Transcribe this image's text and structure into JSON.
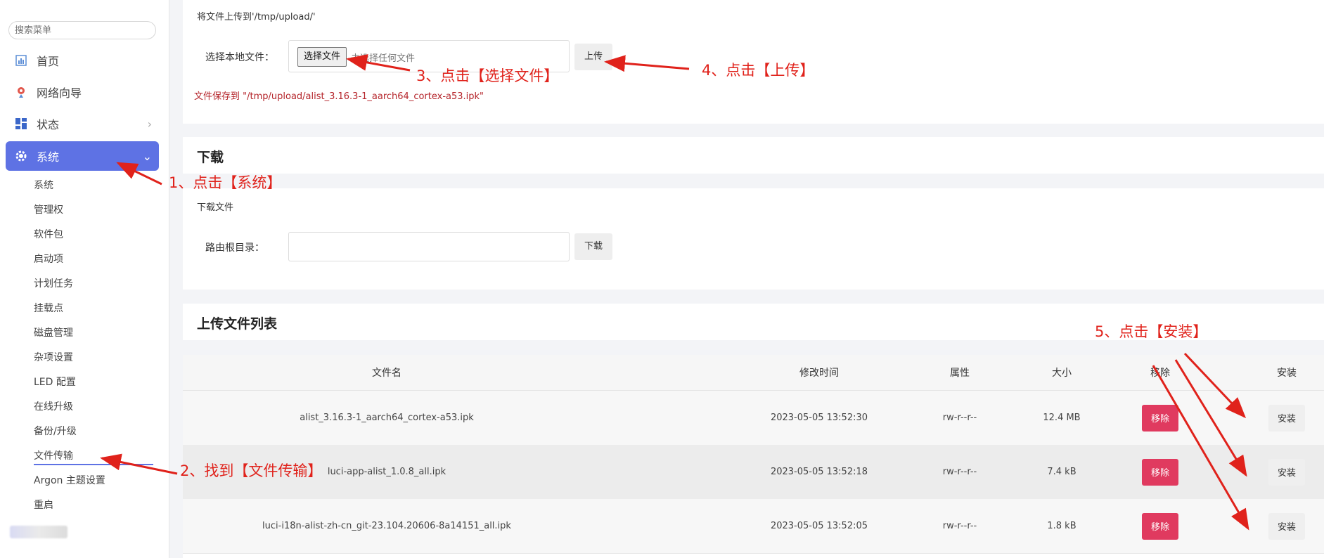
{
  "sidebar": {
    "search_placeholder": "搜索菜单",
    "items": [
      {
        "label": "首页",
        "icon": "chart-icon"
      },
      {
        "label": "网络向导",
        "icon": "pin-icon"
      },
      {
        "label": "状态",
        "icon": "grid-icon"
      },
      {
        "label": "系统",
        "icon": "gear-icon",
        "active": true
      }
    ],
    "sub_items": [
      "系统",
      "管理权",
      "软件包",
      "启动项",
      "计划任务",
      "挂载点",
      "磁盘管理",
      "杂项设置",
      "LED 配置",
      "在线升级",
      "备份/升级",
      "文件传输",
      "Argon 主题设置",
      "重启"
    ],
    "current_sub": "文件传输",
    "accent": "#5e72e4"
  },
  "upload": {
    "description": "将文件上传到'/tmp/upload/'",
    "local_file_label": "选择本地文件：",
    "choose_button": "选择文件",
    "no_file_text": "未选择任何文件",
    "upload_button": "上传",
    "saved_message": "文件保存到 \"/tmp/upload/alist_3.16.3-1_aarch64_cortex-a53.ipk\""
  },
  "download": {
    "title": "下载",
    "description": "下载文件",
    "path_label": "路由根目录：",
    "path_value": "",
    "download_button": "下载"
  },
  "file_list": {
    "title": "上传文件列表",
    "headers": {
      "name": "文件名",
      "mtime": "修改时间",
      "attr": "属性",
      "size": "大小",
      "remove": "移除",
      "install": "安装"
    },
    "rows": [
      {
        "name": "alist_3.16.3-1_aarch64_cortex-a53.ipk",
        "mtime": "2023-05-05 13:52:30",
        "attr": "rw-r--r--",
        "size": "12.4 MB",
        "remove": "移除",
        "install": "安装"
      },
      {
        "name": "luci-app-alist_1.0.8_all.ipk",
        "mtime": "2023-05-05 13:52:18",
        "attr": "rw-r--r--",
        "size": "7.4 kB",
        "remove": "移除",
        "install": "安装"
      },
      {
        "name": "luci-i18n-alist-zh-cn_git-23.104.20606-8a14151_all.ipk",
        "mtime": "2023-05-05 13:52:05",
        "attr": "rw-r--r--",
        "size": "1.8 kB",
        "remove": "移除",
        "install": "安装"
      }
    ],
    "remove_color": "#e03a5f"
  },
  "annotations": {
    "step1": "1、点击【系统】",
    "step2": "2、找到【文件传输】",
    "step3": "3、点击【选择文件】",
    "step4": "4、点击【上传】",
    "step5": "5、点击【安装】",
    "color": "#e0221b"
  }
}
